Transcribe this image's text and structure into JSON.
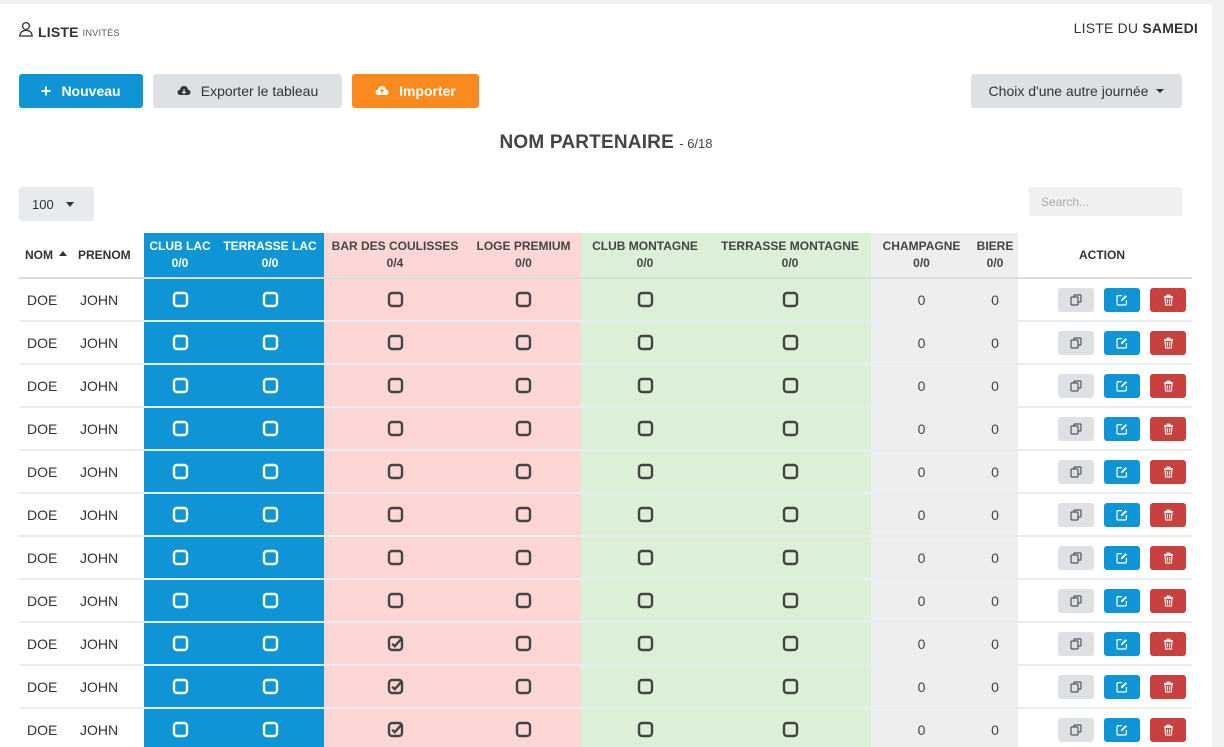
{
  "header": {
    "brand_main": "LISTE",
    "brand_sub": "INVITÉS",
    "list_prefix": "LISTE DU",
    "list_day": "SAMEDI"
  },
  "toolbar": {
    "new_label": "Nouveau",
    "export_label": "Exporter le tableau",
    "import_label": "Importer",
    "day_label": "Choix d'une autre journée"
  },
  "title": {
    "main": "NOM PARTENAIRE",
    "sub": "- 6/18"
  },
  "controls": {
    "page_size": "100",
    "search_placeholder": "Search..."
  },
  "colors": {
    "blue": "#0f95d6",
    "pink": "#fdd6d6",
    "green": "#dcefd7",
    "grey": "#eeeeee",
    "orange": "#fb8a1e",
    "danger": "#c9413e"
  },
  "table": {
    "col_nom": "NOM",
    "col_prenom": "PRENOM",
    "col_club_lac": "CLUB LAC",
    "col_club_lac_count": "0/0",
    "col_terrasse_lac": "TERRASSE LAC",
    "col_terrasse_lac_count": "0/0",
    "col_bar": "BAR DES COULISSES",
    "col_bar_count": "0/4",
    "col_loge": "LOGE PREMIUM",
    "col_loge_count": "0/0",
    "col_club_montagne": "CLUB MONTAGNE",
    "col_club_montagne_count": "0/0",
    "col_terrasse_montagne": "TERRASSE MONTAGNE",
    "col_terrasse_montagne_count": "0/0",
    "col_champagne": "CHAMPAGNE",
    "col_champagne_count": "0/0",
    "col_biere": "BIERE",
    "col_biere_count": "0/0",
    "col_action": "ACTION",
    "rows": [
      {
        "nom": "DOE",
        "prenom": "JOHN",
        "club_lac": false,
        "terrasse_lac": false,
        "bar": false,
        "loge": false,
        "club_montagne": false,
        "terrasse_montagne": false,
        "champagne": "0",
        "biere": "0"
      },
      {
        "nom": "DOE",
        "prenom": "JOHN",
        "club_lac": false,
        "terrasse_lac": false,
        "bar": false,
        "loge": false,
        "club_montagne": false,
        "terrasse_montagne": false,
        "champagne": "0",
        "biere": "0"
      },
      {
        "nom": "DOE",
        "prenom": "JOHN",
        "club_lac": false,
        "terrasse_lac": false,
        "bar": false,
        "loge": false,
        "club_montagne": false,
        "terrasse_montagne": false,
        "champagne": "0",
        "biere": "0"
      },
      {
        "nom": "DOE",
        "prenom": "JOHN",
        "club_lac": false,
        "terrasse_lac": false,
        "bar": false,
        "loge": false,
        "club_montagne": false,
        "terrasse_montagne": false,
        "champagne": "0",
        "biere": "0"
      },
      {
        "nom": "DOE",
        "prenom": "JOHN",
        "club_lac": false,
        "terrasse_lac": false,
        "bar": false,
        "loge": false,
        "club_montagne": false,
        "terrasse_montagne": false,
        "champagne": "0",
        "biere": "0"
      },
      {
        "nom": "DOE",
        "prenom": "JOHN",
        "club_lac": false,
        "terrasse_lac": false,
        "bar": false,
        "loge": false,
        "club_montagne": false,
        "terrasse_montagne": false,
        "champagne": "0",
        "biere": "0"
      },
      {
        "nom": "DOE",
        "prenom": "JOHN",
        "club_lac": false,
        "terrasse_lac": false,
        "bar": false,
        "loge": false,
        "club_montagne": false,
        "terrasse_montagne": false,
        "champagne": "0",
        "biere": "0"
      },
      {
        "nom": "DOE",
        "prenom": "JOHN",
        "club_lac": false,
        "terrasse_lac": false,
        "bar": false,
        "loge": false,
        "club_montagne": false,
        "terrasse_montagne": false,
        "champagne": "0",
        "biere": "0"
      },
      {
        "nom": "DOE",
        "prenom": "JOHN",
        "club_lac": false,
        "terrasse_lac": false,
        "bar": true,
        "loge": false,
        "club_montagne": false,
        "terrasse_montagne": false,
        "champagne": "0",
        "biere": "0"
      },
      {
        "nom": "DOE",
        "prenom": "JOHN",
        "club_lac": false,
        "terrasse_lac": false,
        "bar": true,
        "loge": false,
        "club_montagne": false,
        "terrasse_montagne": false,
        "champagne": "0",
        "biere": "0"
      },
      {
        "nom": "DOE",
        "prenom": "JOHN",
        "club_lac": false,
        "terrasse_lac": false,
        "bar": true,
        "loge": false,
        "club_montagne": false,
        "terrasse_montagne": false,
        "champagne": "0",
        "biere": "0"
      }
    ]
  }
}
